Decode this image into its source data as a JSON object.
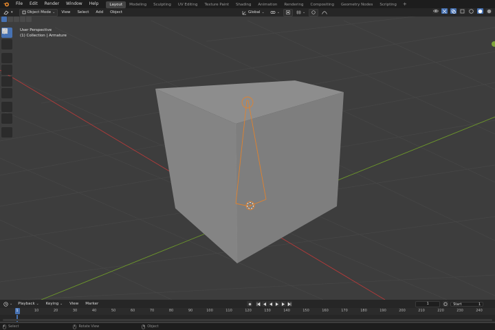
{
  "menubar": {
    "items": [
      "File",
      "Edit",
      "Render",
      "Window",
      "Help"
    ],
    "workspaces": [
      {
        "label": "Layout",
        "active": true
      },
      {
        "label": "Modeling",
        "active": false
      },
      {
        "label": "Sculpting",
        "active": false
      },
      {
        "label": "UV Editing",
        "active": false
      },
      {
        "label": "Texture Paint",
        "active": false
      },
      {
        "label": "Shading",
        "active": false
      },
      {
        "label": "Animation",
        "active": false
      },
      {
        "label": "Rendering",
        "active": false
      },
      {
        "label": "Compositing",
        "active": false
      },
      {
        "label": "Geometry Nodes",
        "active": false
      },
      {
        "label": "Scripting",
        "active": false
      }
    ],
    "add_label": "+"
  },
  "header": {
    "mode": "Object Mode",
    "menus": [
      "View",
      "Select",
      "Add",
      "Object"
    ],
    "transform_orientation": "Global"
  },
  "viewport": {
    "perspective_label": "User Perspective",
    "collection_label": "(1) Collection | Armature"
  },
  "timeline": {
    "menus": [
      "Playback",
      "Keying",
      "View",
      "Marker"
    ],
    "current_frame": "1",
    "start_label": "Start",
    "start_value": "1",
    "ticks": [
      "1",
      "10",
      "20",
      "30",
      "40",
      "50",
      "60",
      "70",
      "80",
      "90",
      "100",
      "110",
      "120",
      "130",
      "140",
      "150",
      "160",
      "170",
      "180",
      "190",
      "200",
      "210",
      "220",
      "230",
      "240"
    ]
  },
  "statusbar": {
    "items": [
      "Select",
      "Rotate View",
      "Object"
    ]
  },
  "colors": {
    "accent": "#4772b3",
    "x_axis": "#b83a3a",
    "y_axis": "#6e9a2a",
    "armature": "#e0822e",
    "cube_face": "#8a8a8a"
  }
}
